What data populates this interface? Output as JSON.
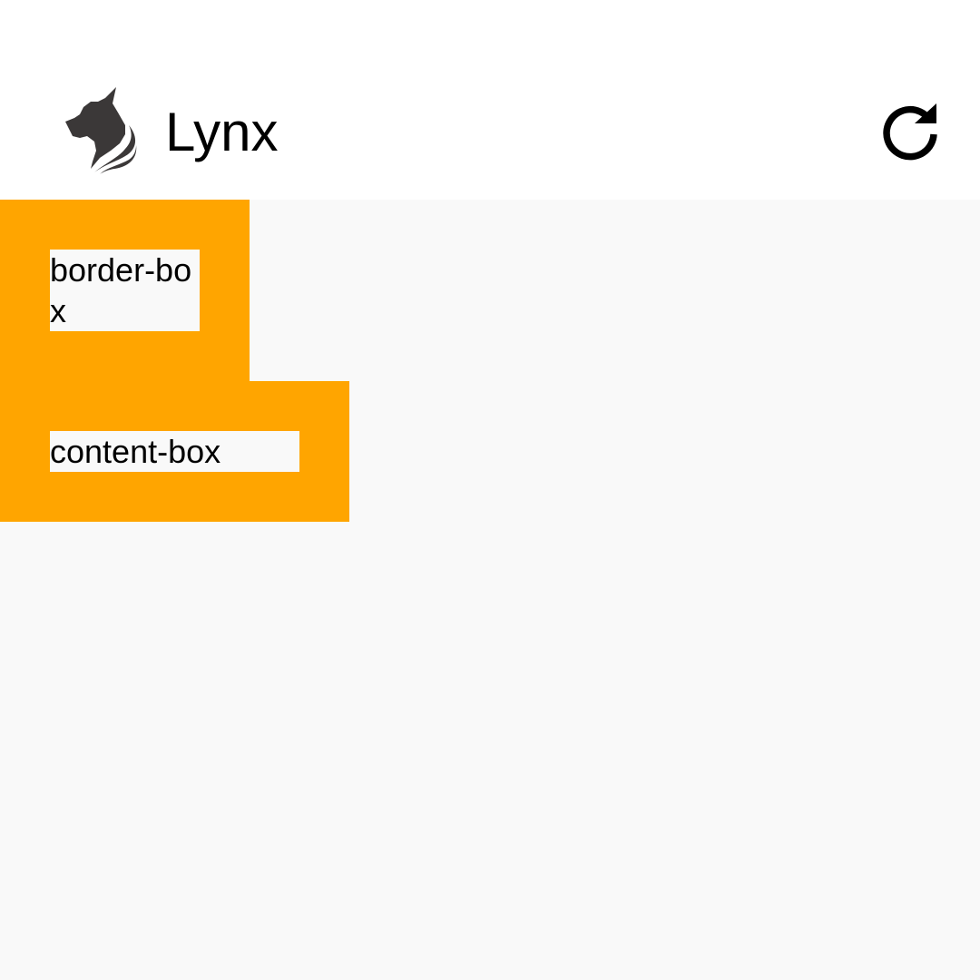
{
  "header": {
    "title": "Lynx",
    "logo_icon": "lynx-logo-icon",
    "reload_icon": "reload-icon"
  },
  "boxes": [
    {
      "label": "border-box"
    },
    {
      "label": "content-box"
    }
  ],
  "colors": {
    "box_background": "#ffa500",
    "page_background": "#f9f9f9",
    "header_background": "#ffffff",
    "text": "#000000"
  }
}
